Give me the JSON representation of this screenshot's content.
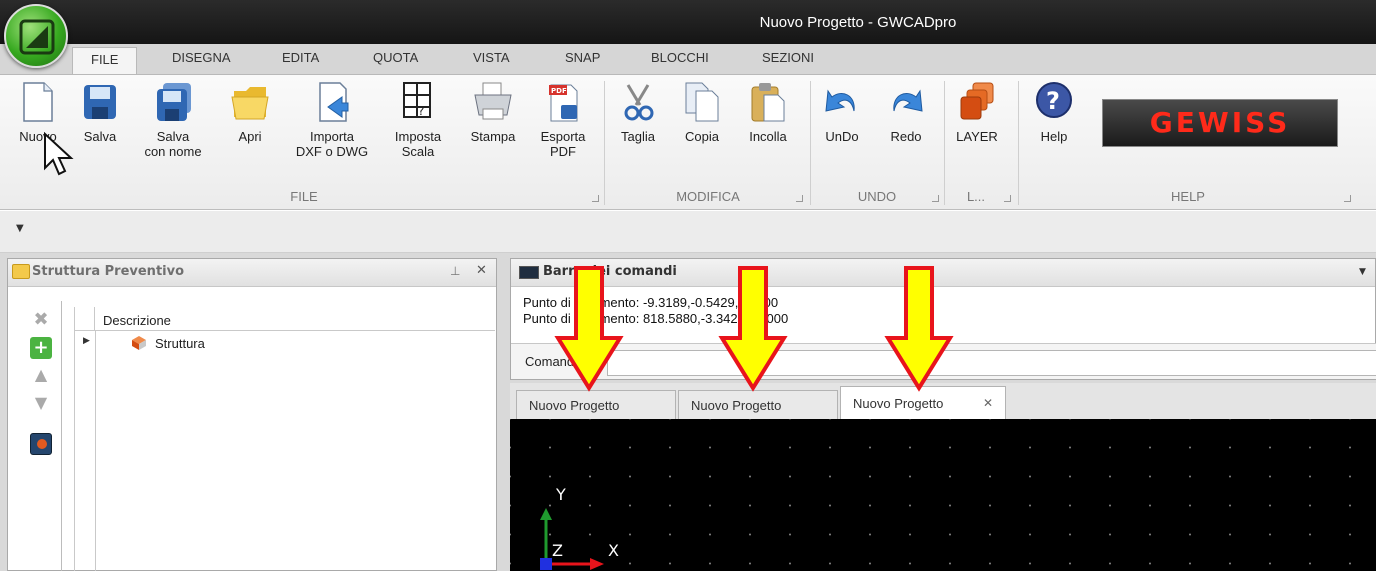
{
  "window": {
    "title": "Nuovo Progetto - GWCADpro"
  },
  "tabs": [
    "FILE",
    "DISEGNA",
    "EDITA",
    "QUOTA",
    "VISTA",
    "SNAP",
    "BLOCCHI",
    "SEZIONI"
  ],
  "ribbon": {
    "file": {
      "nuovo": "Nuovo",
      "salva": "Salva",
      "salva_nome_1": "Salva",
      "salva_nome_2": "con nome",
      "apri": "Apri",
      "importa_1": "Importa",
      "importa_2": "DXF o DWG",
      "imposta_1": "Imposta",
      "imposta_2": "Scala",
      "stampa": "Stampa",
      "esporta_1": "Esporta",
      "esporta_2": "PDF",
      "group": "FILE"
    },
    "modifica": {
      "taglia": "Taglia",
      "copia": "Copia",
      "incolla": "Incolla",
      "group": "MODIFICA"
    },
    "undo": {
      "undo": "UnDo",
      "redo": "Redo",
      "group": "UNDO"
    },
    "layer": {
      "layer": "LAYER",
      "group": "L..."
    },
    "help": {
      "help": "Help",
      "group": "HELP",
      "logo": "GEWISS"
    }
  },
  "left_panel": {
    "title": "Struttura Preventivo",
    "column": "Descrizione",
    "row": "Struttura"
  },
  "command_panel": {
    "title": "Barra dei comandi",
    "log_line1": "Punto di riferimento: -9.3189,-0.5429,0.0000",
    "log_line2": "Punto di riferimento: 818.5880,-3.3421,0.0000",
    "command_label": "Comando:"
  },
  "doc_tabs": [
    "Nuovo Progetto",
    "Nuovo Progetto",
    "Nuovo Progetto"
  ],
  "canvas": {
    "y_axis": "Y",
    "z_axis": "Z",
    "x_axis": "X"
  },
  "colors": {
    "accent_green": "#36a81f",
    "arrow_yellow": "#ffff00",
    "arrow_outline": "#e8141b",
    "gewiss_red": "#ff2a1a"
  }
}
